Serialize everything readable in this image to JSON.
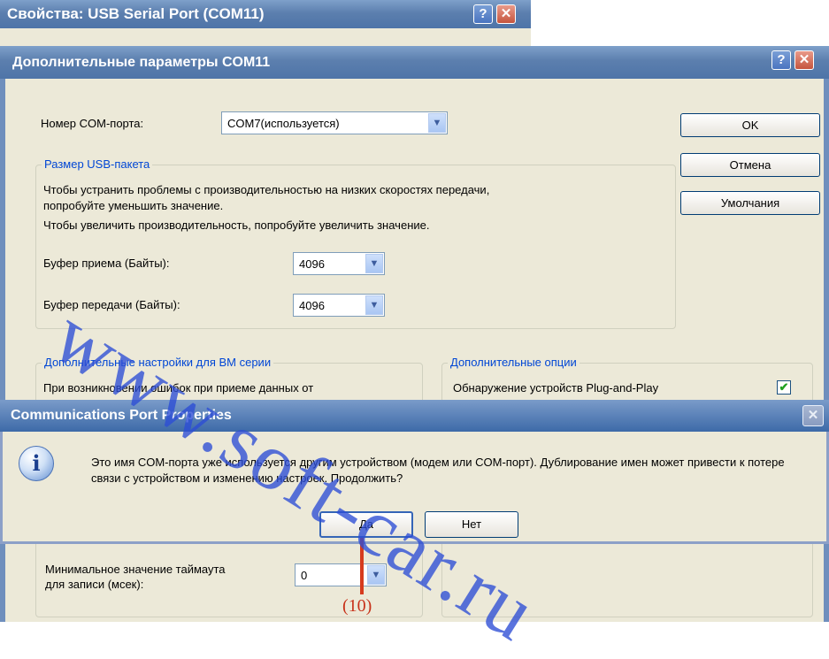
{
  "back_window": {
    "title": "Свойства: USB Serial Port (COM11)",
    "help_glyph": "?",
    "close_glyph": "✕"
  },
  "main_window": {
    "title": "Дополнительные параметры COM11",
    "help_glyph": "?",
    "close_glyph": "✕",
    "com_port_label": "Номер COM-порта:",
    "com_port_value": "COM7(используется)",
    "buttons": {
      "ok": "OK",
      "cancel": "Отмена",
      "defaults": "Умолчания"
    },
    "usb_group": {
      "title": "Размер USB-пакета",
      "text_line1": "Чтобы устранить проблемы с производительностью на низких скоростях передачи,",
      "text_line2": "попробуйте уменьшить значение.",
      "text_line3": "Чтобы увеличить производительность, попробуйте увеличить значение.",
      "rx_label": "Буфер приема (Байты):",
      "rx_value": "4096",
      "tx_label": "Буфер передачи (Байты):",
      "tx_value": "4096"
    },
    "bm_group": {
      "title": "Дополнительные настройки для BM серии",
      "text": "При возникновении ошибок при приеме данных от",
      "min_timeout_label_line1": "Минимальное значение таймаута",
      "min_timeout_label_line2": "для записи (мсек):",
      "min_timeout_value": "0"
    },
    "options_group": {
      "title": "Дополнительные опции",
      "pnp_label": "Обнаружение устройств Plug-and-Play",
      "pnp_checked": true,
      "check_glyph": "✔"
    }
  },
  "dialog": {
    "title": "Communications Port Properties",
    "close_glyph": "✕",
    "icon_glyph": "i",
    "message": "Это имя COM-порта уже используется другим устройством (модем или COM-порт). Дублирование имен может привести к потере связи с устройством и изменению настроек. Продолжить?",
    "yes": "Да",
    "no": "Нет"
  },
  "annotation": {
    "callout": "(10)",
    "color": "#d63b1e"
  },
  "watermark": "www.soft-car.ru",
  "dropdown_glyph": "▼"
}
